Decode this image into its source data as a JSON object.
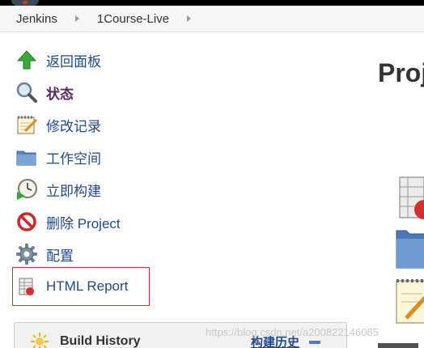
{
  "breadcrumbs": [
    "Jenkins",
    "1Course-Live"
  ],
  "sidebar": {
    "items": [
      {
        "label": "返回面板",
        "icon": "up-arrow-icon"
      },
      {
        "label": "状态",
        "icon": "search-icon"
      },
      {
        "label": "修改记录",
        "icon": "notepad-icon"
      },
      {
        "label": "工作空间",
        "icon": "folder-icon"
      },
      {
        "label": "立即构建",
        "icon": "build-clock-icon"
      },
      {
        "label": "删除 Project",
        "icon": "no-entry-icon"
      },
      {
        "label": "配置",
        "icon": "gear-icon"
      },
      {
        "label": "HTML Report",
        "icon": "report-icon"
      }
    ]
  },
  "build_history": {
    "title": "Build History",
    "link": "构建历史"
  },
  "main": {
    "title": "Proj"
  },
  "watermark": "https://blog.csdn.net/a200822146085"
}
